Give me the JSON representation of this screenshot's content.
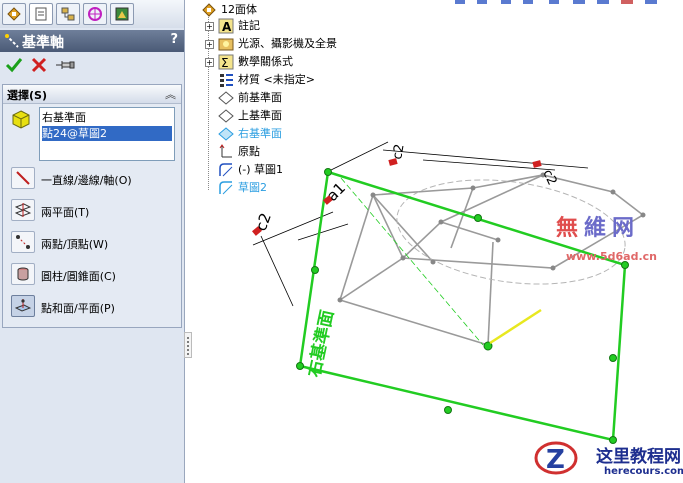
{
  "panel": {
    "title": "基準軸",
    "help": "?",
    "tabs": [
      "feature-manager",
      "property-manager",
      "configuration-manager",
      "dimxpert-manager",
      "display-manager"
    ],
    "actions": {
      "ok": "ok-check-icon",
      "cancel": "cancel-x-icon",
      "pin": "pushpin-icon"
    },
    "selection": {
      "header": "選擇(S)",
      "items": [
        "右基準面",
        "點24@草圖2"
      ],
      "selected_index": 1
    },
    "options": [
      {
        "label": "一直線/邊線/軸(O)",
        "icon": "line-edge-axis-icon",
        "pressed": false
      },
      {
        "label": "兩平面(T)",
        "icon": "two-planes-icon",
        "pressed": false
      },
      {
        "label": "兩點/頂點(W)",
        "icon": "two-points-icon",
        "pressed": false
      },
      {
        "label": "圓柱/圓錐面(C)",
        "icon": "cylinder-cone-icon",
        "pressed": false
      },
      {
        "label": "點和面/平面(P)",
        "icon": "point-and-plane-icon",
        "pressed": true
      }
    ]
  },
  "tree": {
    "root": "12面体",
    "items": [
      {
        "label": "註記",
        "icon": "annotations-icon",
        "expandable": true
      },
      {
        "label": "光源、攝影機及全景",
        "icon": "lights-cameras-icon",
        "expandable": true
      },
      {
        "label": "數學關係式",
        "icon": "equations-icon",
        "expandable": true
      },
      {
        "label": "材質 <未指定>",
        "icon": "material-icon",
        "expandable": false
      },
      {
        "label": "前基準面",
        "icon": "plane-icon",
        "expandable": false
      },
      {
        "label": "上基準面",
        "icon": "plane-icon",
        "expandable": false
      },
      {
        "label": "右基準面",
        "icon": "plane-icon-selected",
        "expandable": false,
        "highlight": true
      },
      {
        "label": "原點",
        "icon": "origin-icon",
        "expandable": false
      },
      {
        "label": "(-) 草圖1",
        "icon": "sketch-icon",
        "expandable": false
      },
      {
        "label": "草圖2",
        "icon": "sketch-icon-active",
        "expandable": false,
        "highlight": true
      }
    ]
  },
  "viewport": {
    "plane_label": "右基準面",
    "dimension_labels": [
      "a1",
      "c2",
      "c2",
      "c2"
    ]
  },
  "watermarks": {
    "wm1a": "無",
    "wm1b": "維",
    "wm1c": "网",
    "site1": "www.5d6ad.cn",
    "brand": "这里教程网",
    "site2": "herecours.com"
  },
  "colors": {
    "selected_plane": "#22cc22",
    "sketch_geometry": "#9a9a9a",
    "axis_preview": "#e8e820",
    "tree_highlight": "#2a9de0",
    "selection_highlight": "#316ac5"
  }
}
